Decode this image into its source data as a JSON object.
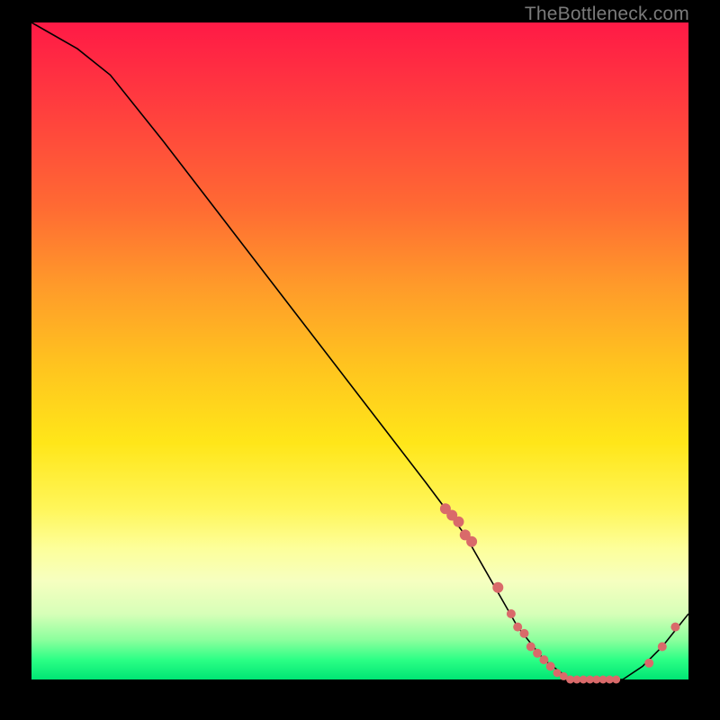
{
  "watermark": "TheBottleneck.com",
  "chart_data": {
    "type": "line",
    "title": "",
    "xlabel": "",
    "ylabel": "",
    "xlim": [
      0,
      100
    ],
    "ylim": [
      0,
      100
    ],
    "series": [
      {
        "name": "bottleneck-curve",
        "x": [
          0,
          7,
          12,
          20,
          30,
          40,
          50,
          60,
          66,
          70,
          74,
          78,
          82,
          86,
          90,
          93,
          96,
          100
        ],
        "y": [
          100,
          96,
          92,
          82,
          69,
          56,
          43,
          30,
          22,
          15,
          8,
          3,
          0,
          0,
          0,
          2,
          5,
          10
        ]
      }
    ],
    "markers": {
      "name": "highlight-points",
      "x": [
        63,
        64,
        65,
        66,
        67,
        71,
        73,
        74,
        75,
        76,
        77,
        78,
        79,
        80,
        81,
        82,
        83,
        84,
        85,
        86,
        87,
        88,
        89,
        94,
        96,
        98
      ],
      "y": [
        26,
        25,
        24,
        22,
        21,
        14,
        10,
        8,
        7,
        5,
        4,
        3,
        2,
        1,
        0.5,
        0,
        0,
        0,
        0,
        0,
        0,
        0,
        0,
        2.5,
        5,
        8
      ]
    }
  },
  "colors": {
    "marker": "#d96a6a",
    "curve": "#000000"
  }
}
